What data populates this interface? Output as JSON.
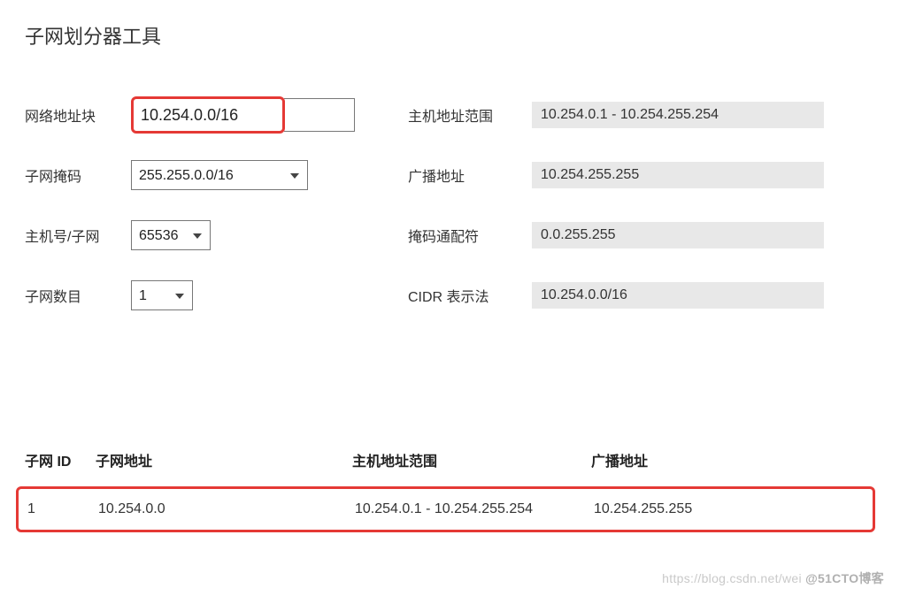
{
  "title": "子网划分器工具",
  "left": {
    "network_block_label": "网络地址块",
    "network_block_value": "10.254.0.0/16",
    "subnet_mask_label": "子网掩码",
    "subnet_mask_value": "255.255.0.0/16",
    "hosts_per_subnet_label": "主机号/子网",
    "hosts_per_subnet_value": "65536",
    "num_subnets_label": "子网数目",
    "num_subnets_value": "1"
  },
  "right": {
    "host_range_label": "主机地址范围",
    "host_range_value": "10.254.0.1  -  10.254.255.254",
    "broadcast_label": "广播地址",
    "broadcast_value": "10.254.255.255",
    "wildcard_label": "掩码通配符",
    "wildcard_value": "0.0.255.255",
    "cidr_label": "CIDR 表示法",
    "cidr_value": "10.254.0.0/16"
  },
  "table": {
    "headers": {
      "id": "子网 ID",
      "addr": "子网地址",
      "range": "主机地址范围",
      "bcast": "广播地址"
    },
    "rows": [
      {
        "id": "1",
        "addr": "10.254.0.0",
        "range": "10.254.0.1 - 10.254.255.254",
        "bcast": "10.254.255.255"
      }
    ]
  },
  "watermark": {
    "faint": "https://blog.csdn.net/wei ",
    "bold": "@51CTO博客"
  }
}
